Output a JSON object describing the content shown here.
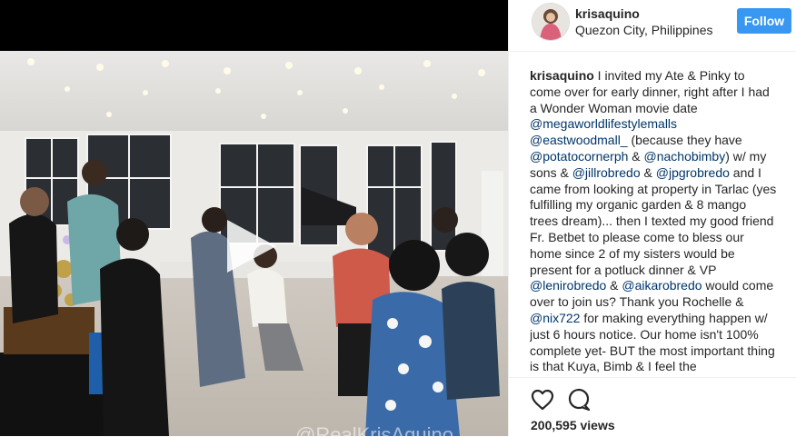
{
  "post": {
    "username": "krisaquino",
    "location": "Quezon City, Philippines",
    "follow_label": "Follow",
    "views": "200,595 views",
    "watermark": "@RealKrisAquino",
    "caption": [
      {
        "t": "u",
        "v": "krisaquino"
      },
      {
        "t": "x",
        "v": " I invited my Ate & Pinky to come over for early dinner, right after I had a Wonder Woman movie date "
      },
      {
        "t": "m",
        "v": "@megaworldlifestylemalls"
      },
      {
        "t": "x",
        "v": " "
      },
      {
        "t": "m",
        "v": "@eastwoodmall_"
      },
      {
        "t": "x",
        "v": " (because they have "
      },
      {
        "t": "m",
        "v": "@potatocornerph"
      },
      {
        "t": "x",
        "v": " & "
      },
      {
        "t": "m",
        "v": "@nachobimby"
      },
      {
        "t": "x",
        "v": ") w/ my sons & "
      },
      {
        "t": "m",
        "v": "@jillrobredo"
      },
      {
        "t": "x",
        "v": " & "
      },
      {
        "t": "m",
        "v": "@jpgrobredo"
      },
      {
        "t": "x",
        "v": " and I came from looking at property in Tarlac (yes fulfilling my organic garden & 8 mango trees dream)... then I texted my good friend Fr. Betbet to please come to bless our home since 2 of my sisters would be present for a potluck dinner & VP "
      },
      {
        "t": "m",
        "v": "@lenirobredo"
      },
      {
        "t": "x",
        "v": " & "
      },
      {
        "t": "m",
        "v": "@aikarobredo"
      },
      {
        "t": "x",
        "v": " would come over to join us? Thank you Rochelle & "
      },
      {
        "t": "m",
        "v": "@nix722"
      },
      {
        "t": "x",
        "v": " for making everything happen w/ just 6 hours notice. Our home isn't 100% complete yet- BUT the most important thing is that Kuya, Bimb & I feel the"
      }
    ]
  },
  "colors": {
    "accent": "#3897f0",
    "mention": "#003569",
    "text": "#262626"
  },
  "icons": {
    "like": "heart-icon",
    "comment": "comment-icon",
    "play": "play-icon"
  }
}
